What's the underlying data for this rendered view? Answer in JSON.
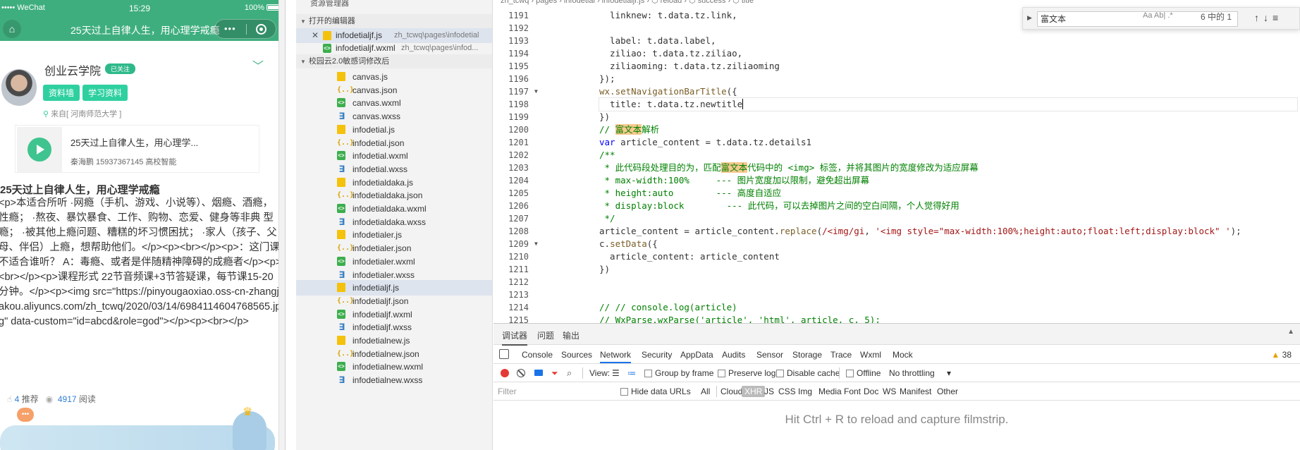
{
  "phone": {
    "status": {
      "carrier": "••••• WeChat",
      "time": "15:29",
      "battery": "100%"
    },
    "nav": {
      "title": "25天过上自律人生，用心理学戒瘾",
      "dots": "•••"
    },
    "author": {
      "name": "创业云学院",
      "badge": "已关注",
      "tag1": "资料墙",
      "tag2": "学习资料",
      "source": "来自[ 河南师范大学 ]"
    },
    "course": {
      "title": "25天过上自律人生，用心理学...",
      "meta": "秦海鹏 15937367145 高校智能"
    },
    "article_title": "25天过上自律人生，用心理学戒瘾",
    "article_body": "<p>本适合所听 ·网瘾（手机、游戏、小说等）、烟瘾、酒瘾，性瘾； ·熬夜、暴饮暴食、工作、购物、恋爱、健身等非典 型瘾； ·被其他上瘾问题、糟糕的坏习惯困扰； ·家人（孩子、父母、伴侣）上瘾，想帮助他们。</p><p><br></p><p>：这门课不适合谁听？ A：毒瘾、或者是伴随精神障碍的成瘾者</p><p><br></p><p>课程形式 22节音频课+3节答疑课，每节课15-20分钟。</p><p><img src=\"https://pinyougaoxiao.oss-cn-zhangjiakou.aliyuncs.com/zh_tcwq/2020/03/14/6984114604768565.jpg\" data-custom=\"id=abcd&role=god\"></p><p><br></p>",
    "stats": {
      "likes": "4",
      "likes_label": "推荐",
      "reads": "4917",
      "reads_label": "阅读"
    },
    "comment_badge": "•••"
  },
  "explorer": {
    "header": "资源管理器",
    "open_editors_label": "打开的编辑器",
    "open_editors": [
      {
        "name": "infodetialjf.js",
        "path": "zh_tcwq\\pages\\infodetial",
        "icon": "js"
      },
      {
        "name": "infodetialjf.wxml",
        "path": "zh_tcwq\\pages\\infod...",
        "icon": "wxml"
      }
    ],
    "project_label": "校园云2.0敏感词修改后",
    "files": [
      {
        "name": "canvas.js",
        "icon": "js"
      },
      {
        "name": "canvas.json",
        "icon": "json"
      },
      {
        "name": "canvas.wxml",
        "icon": "wxml"
      },
      {
        "name": "canvas.wxss",
        "icon": "wxss"
      },
      {
        "name": "infodetial.js",
        "icon": "js"
      },
      {
        "name": "infodetial.json",
        "icon": "json"
      },
      {
        "name": "infodetial.wxml",
        "icon": "wxml"
      },
      {
        "name": "infodetial.wxss",
        "icon": "wxss"
      },
      {
        "name": "infodetialdaka.js",
        "icon": "js"
      },
      {
        "name": "infodetialdaka.json",
        "icon": "json"
      },
      {
        "name": "infodetialdaka.wxml",
        "icon": "wxml"
      },
      {
        "name": "infodetialdaka.wxss",
        "icon": "wxss"
      },
      {
        "name": "infodetialer.js",
        "icon": "js"
      },
      {
        "name": "infodetialer.json",
        "icon": "json"
      },
      {
        "name": "infodetialer.wxml",
        "icon": "wxml"
      },
      {
        "name": "infodetialer.wxss",
        "icon": "wxss"
      },
      {
        "name": "infodetialjf.js",
        "icon": "js"
      },
      {
        "name": "infodetialjf.json",
        "icon": "json"
      },
      {
        "name": "infodetialjf.wxml",
        "icon": "wxml"
      },
      {
        "name": "infodetialjf.wxss",
        "icon": "wxss"
      },
      {
        "name": "infodetialnew.js",
        "icon": "js"
      },
      {
        "name": "infodetialnew.json",
        "icon": "json"
      },
      {
        "name": "infodetialnew.wxml",
        "icon": "wxml"
      },
      {
        "name": "infodetialnew.wxss",
        "icon": "wxss"
      }
    ],
    "selected_file": "infodetialjf.js"
  },
  "editor": {
    "breadcrumb": "zh_tcwq  ›  pages  ›  infodetial  ›  infodetialjf.js  ›  ⬡ reload  ›  ⬡ success  ›  ⬡ title",
    "current_line": "1198",
    "find": {
      "query": "富文本",
      "options": "Aa  Ab|  .*",
      "count": "6 中的 1",
      "buttons": "↑↓≡"
    }
  },
  "devtools": {
    "tabs": [
      "调试器",
      "问题",
      "输出"
    ],
    "panel_tabs": [
      "Console",
      "Sources",
      "Network",
      "Security",
      "AppData",
      "Audits",
      "Sensor",
      "Storage",
      "Trace",
      "Wxml",
      "Mock"
    ],
    "active_panel": "Network",
    "warnings": "38",
    "toolbar": {
      "view_label": "View:",
      "group_by_frame": "Group by frame",
      "preserve_log": "Preserve log",
      "disable_cache": "Disable cache",
      "offline": "Offline",
      "throttling": "No throttling"
    },
    "filter_placeholder": "Filter",
    "hide_data_urls": "Hide data URLs",
    "filter_types": [
      "All",
      "Cloud",
      "XHR",
      "JS",
      "CSS",
      "Img",
      "Media",
      "Font",
      "Doc",
      "WS",
      "Manifest",
      "Other"
    ],
    "active_filter_type": "XHR",
    "empty_message": "Hit Ctrl + R to reload and capture filmstrip."
  }
}
